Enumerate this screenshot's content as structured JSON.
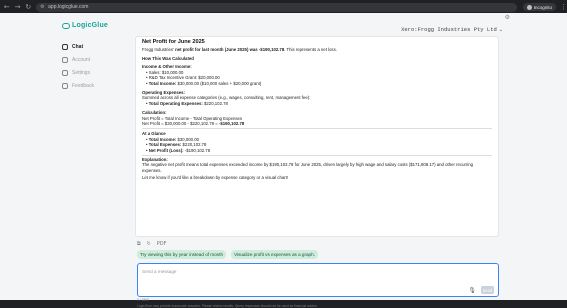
{
  "browser": {
    "url": "app.logicglue.com",
    "incognito_label": "Incognito"
  },
  "sidebar": {
    "brand": "LogicGlue",
    "items": [
      {
        "label": "Chat",
        "active": true
      },
      {
        "label": "Account",
        "active": false
      },
      {
        "label": "Settings",
        "active": false
      },
      {
        "label": "Feedback",
        "active": false
      }
    ]
  },
  "header": {
    "org": "Xero:Frogg Industries Pty Ltd"
  },
  "message": {
    "title": "Net Profit for June 2025",
    "intro_prefix": "Frogg Industries'",
    "intro_bold": "net profit for last month (June 2025) was -$190,102.78",
    "intro_suffix": ". This represents a net loss.",
    "how_heading": "How This Was Calculated",
    "income_heading": "Income & Other Income:",
    "income_items": [
      "Sales: $10,000.00",
      "R&D Tax Incentive Grant: $20,000.00"
    ],
    "total_income_label": "Total Income:",
    "total_income_value": "$30,000.00 ($10,000 sales + $20,000 grant)",
    "opex_heading": "Operating Expenses:",
    "opex_desc": "Summed across all expense categories (e.g., wages, consulting, rent, management fee):",
    "opex_total_label": "Total Operating Expenses:",
    "opex_total_value": "$220,102.78",
    "calc_heading": "Calculation:",
    "calc_line1": "Net Profit = Total Income - Total Operating Expenses",
    "calc_line2_prefix": "Net Profit = $30,000.00 - $220,102.78 =",
    "calc_line2_bold": "-$190,102.78",
    "glance_heading": "At a Glance",
    "glance_items": [
      {
        "label": "Total Income:",
        "value": "$30,000.00"
      },
      {
        "label": "Total Expenses:",
        "value": "$220,102.78"
      },
      {
        "label": "Net Profit (Loss):",
        "value": "-$190,102.78"
      }
    ],
    "explanation_heading": "Explanation:",
    "explanation": "The negative net profit means total expenses exceeded income by $190,102.78 for June 2025, driven largely by high wage and salary costs ($171,808.17) and other recurring expenses.",
    "closing": "Let me know if you'd like a breakdown by expense category or a visual chart!"
  },
  "message_actions": {
    "copy_icon": "copy-icon",
    "refresh_icon": "refresh-icon",
    "label": "PDF"
  },
  "suggestions": [
    "Try viewing this by year instead of month",
    "Visualize profit vs expenses as a graph."
  ],
  "composer": {
    "placeholder": "Send a message",
    "send_label": "Send",
    "counter": "0 / 1500"
  },
  "disclaimer": "LogicGlue may provide inaccurate answers. Please review results. Query responses should not be used as financial advice."
}
